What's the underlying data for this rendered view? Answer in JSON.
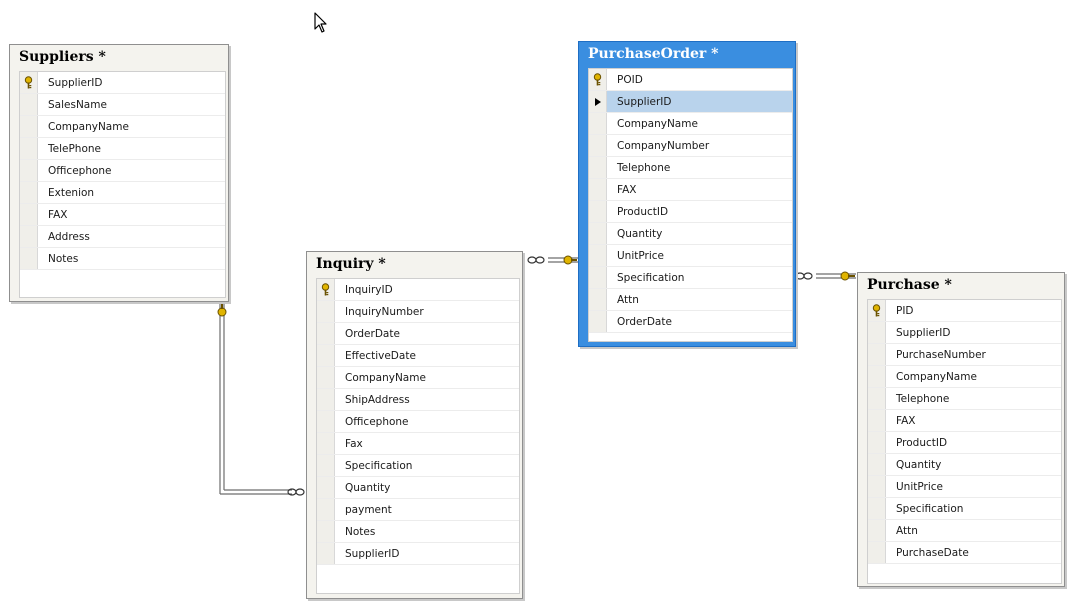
{
  "tables": {
    "suppliers": {
      "title": "Suppliers *",
      "columns": [
        {
          "name": "SupplierID",
          "key": true
        },
        {
          "name": "SalesName"
        },
        {
          "name": "CompanyName"
        },
        {
          "name": "TelePhone"
        },
        {
          "name": "Officephone"
        },
        {
          "name": "Extenion"
        },
        {
          "name": "FAX"
        },
        {
          "name": "Address"
        },
        {
          "name": "Notes"
        }
      ]
    },
    "inquiry": {
      "title": "Inquiry *",
      "columns": [
        {
          "name": "InquiryID",
          "key": true
        },
        {
          "name": "InquiryNumber"
        },
        {
          "name": "OrderDate"
        },
        {
          "name": "EffectiveDate"
        },
        {
          "name": "CompanyName"
        },
        {
          "name": "ShipAddress"
        },
        {
          "name": "Officephone"
        },
        {
          "name": "Fax"
        },
        {
          "name": "Specification"
        },
        {
          "name": "Quantity"
        },
        {
          "name": "payment"
        },
        {
          "name": "Notes"
        },
        {
          "name": "SupplierID"
        }
      ]
    },
    "purchase_order": {
      "title": "PurchaseOrder *",
      "selected": true,
      "columns": [
        {
          "name": "POID",
          "key": true
        },
        {
          "name": "SupplierID",
          "current": true
        },
        {
          "name": "CompanyName"
        },
        {
          "name": "CompanyNumber"
        },
        {
          "name": "Telephone"
        },
        {
          "name": "FAX"
        },
        {
          "name": "ProductID"
        },
        {
          "name": "Quantity"
        },
        {
          "name": "UnitPrice"
        },
        {
          "name": "Specification"
        },
        {
          "name": "Attn"
        },
        {
          "name": "OrderDate"
        }
      ]
    },
    "purchase": {
      "title": "Purchase *",
      "columns": [
        {
          "name": "PID",
          "key": true
        },
        {
          "name": "SupplierID"
        },
        {
          "name": "PurchaseNumber"
        },
        {
          "name": "CompanyName"
        },
        {
          "name": "Telephone"
        },
        {
          "name": "FAX"
        },
        {
          "name": "ProductID"
        },
        {
          "name": "Quantity"
        },
        {
          "name": "UnitPrice"
        },
        {
          "name": "Specification"
        },
        {
          "name": "Attn"
        },
        {
          "name": "PurchaseDate"
        }
      ]
    }
  },
  "relationships": [
    {
      "from": "suppliers",
      "to": "inquiry"
    },
    {
      "from": "purchase_order",
      "to": "inquiry"
    },
    {
      "from": "purchase",
      "to": "purchase_order"
    }
  ],
  "colors": {
    "selected_title_bg": "#3a8ee0",
    "active_row_bg": "#b9d3ec",
    "key_icon": "#e0b400"
  }
}
